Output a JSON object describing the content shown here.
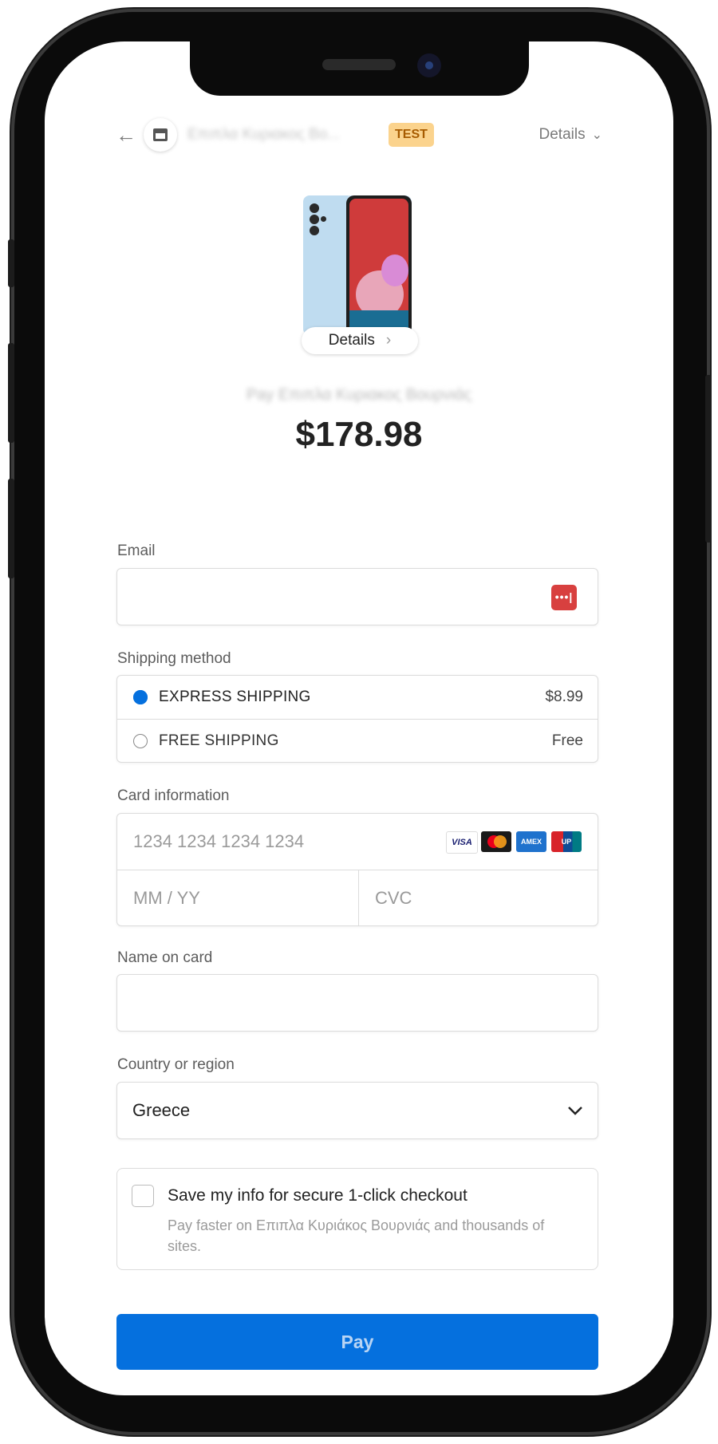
{
  "header": {
    "back_icon": "arrow-left-icon",
    "store_icon": "storefront-icon",
    "store_name": "Επιπλα Κυριακος Βο...",
    "badge": "TEST",
    "details_label": "Details"
  },
  "product": {
    "details_pill_label": "Details",
    "pay_to_text": "Pay Επιπλα Κυριακος Βουρνιάς",
    "price": "$178.98"
  },
  "email": {
    "label": "Email",
    "value": "",
    "autofill_icon": "password-autofill-icon",
    "autofill_glyph": "•••|"
  },
  "shipping": {
    "label": "Shipping method",
    "options": [
      {
        "name": "EXPRESS SHIPPING",
        "price": "$8.99",
        "selected": true
      },
      {
        "name": "FREE SHIPPING",
        "price": "Free",
        "selected": false
      }
    ]
  },
  "card": {
    "label": "Card information",
    "number_placeholder": "1234 1234 1234 1234",
    "expiry_placeholder": "MM / YY",
    "cvc_placeholder": "CVC",
    "brands": [
      "VISA",
      "Mastercard",
      "American Express",
      "UnionPay"
    ],
    "brand_visa_text": "VISA",
    "brand_amex_text": "AMEX",
    "brand_unionpay_text": "UP"
  },
  "name": {
    "label": "Name on card",
    "value": ""
  },
  "country": {
    "label": "Country or region",
    "value": "Greece"
  },
  "save_info": {
    "title": "Save my info for secure 1-click checkout",
    "subtitle": "Pay faster on Επιπλα Κυριάκος Βουρνιάς and thousands of sites.",
    "checked": false
  },
  "pay_button": {
    "label": "Pay"
  },
  "colors": {
    "accent": "#0570de",
    "badge_bg": "#fbd38d",
    "badge_text": "#a75b00"
  }
}
